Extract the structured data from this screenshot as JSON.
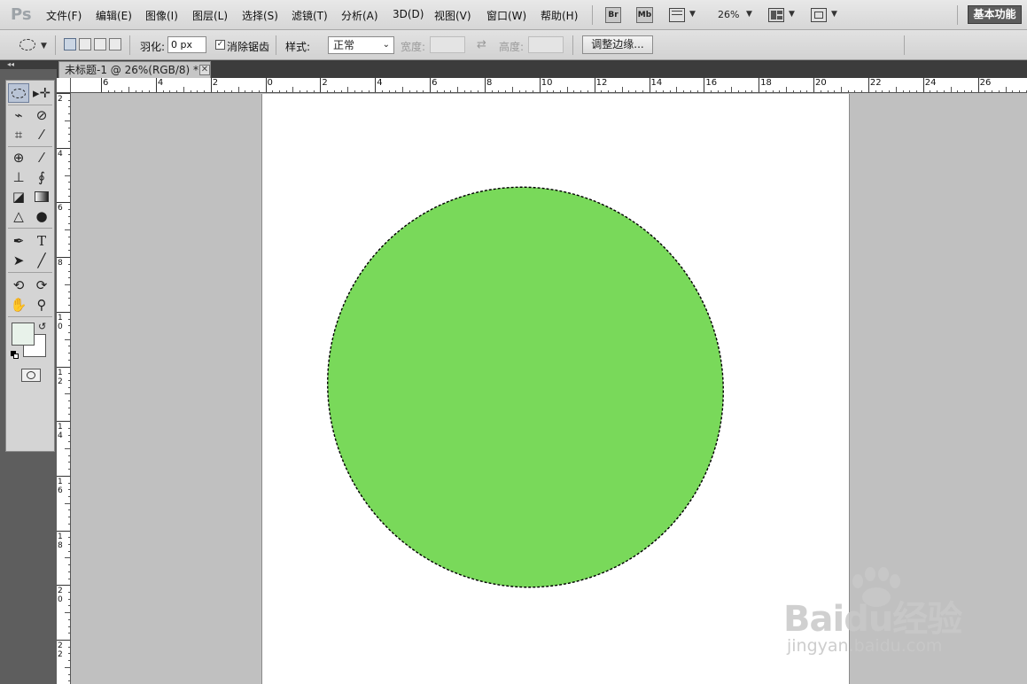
{
  "app": {
    "logo": "Ps"
  },
  "menu": [
    {
      "id": "file",
      "label": "文件(F)"
    },
    {
      "id": "edit",
      "label": "编辑(E)"
    },
    {
      "id": "image",
      "label": "图像(I)"
    },
    {
      "id": "layer",
      "label": "图层(L)"
    },
    {
      "id": "select",
      "label": "选择(S)"
    },
    {
      "id": "filter",
      "label": "滤镜(T)"
    },
    {
      "id": "analysis",
      "label": "分析(A)"
    },
    {
      "id": "3d",
      "label": "3D(D)"
    },
    {
      "id": "view",
      "label": "视图(V)"
    },
    {
      "id": "window",
      "label": "窗口(W)"
    },
    {
      "id": "help",
      "label": "帮助(H)"
    }
  ],
  "app_bar": {
    "bridge_label": "Br",
    "minibridge_label": "Mb",
    "zoom": "26%",
    "workspace": "基本功能"
  },
  "options": {
    "feather_label": "羽化:",
    "feather_value": "0 px",
    "antialias_label": "消除锯齿",
    "antialias_checked": "✓",
    "style_label": "样式:",
    "style_value": "正常",
    "width_label": "宽度:",
    "height_label": "高度:",
    "swap_icon": "⇄",
    "refine_edge_label": "调整边缘..."
  },
  "document": {
    "tab_title": "未标题-1 @ 26%(RGB/8) *",
    "ruler_top": [
      "6",
      "4",
      "2",
      "0",
      "2",
      "4",
      "6",
      "8",
      "10",
      "12",
      "14",
      "16",
      "18",
      "20",
      "22",
      "24",
      "26"
    ],
    "ruler_left": [
      "2",
      "4",
      "6",
      "8",
      "10",
      "12",
      "14",
      "16",
      "18",
      "20",
      "22"
    ],
    "fill_color": "#79d95a",
    "foreground_color": "#e8f2ea",
    "background_color": "#ffffff"
  },
  "watermark": {
    "brand": "Baidu经验",
    "url": "jingyan.baidu.com"
  },
  "icons": {
    "ps_logo": "ps-logo-icon",
    "marquee_tool": "elliptical-marquee-icon",
    "move_tool": "move-tool-icon",
    "lasso_tool": "lasso-icon",
    "quick_select": "quick-selection-icon",
    "crop": "crop-icon",
    "eyedropper": "eyedropper-icon"
  }
}
